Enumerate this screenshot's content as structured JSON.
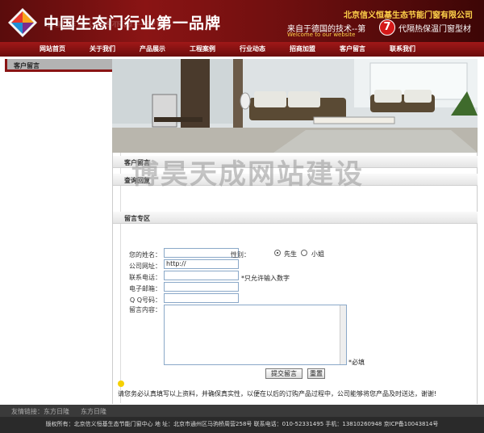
{
  "header": {
    "logo_title": "中国生态门行业第一品牌",
    "company": "北京信义恒基生态节能门窗有限公司",
    "slogan": "来自于德国的技术--第",
    "slogan_number": "7",
    "slogan_suffix": "代隔热保温门窗型材",
    "slogan_en": "Welcome to our website"
  },
  "nav": {
    "items": [
      "网站首页",
      "关于我们",
      "产品展示",
      "工程案例",
      "行业动态",
      "招商加盟",
      "客户留言",
      "联系我们"
    ]
  },
  "sidebar": {
    "title": "客户留言"
  },
  "content": {
    "breadcrumb": "客户留言",
    "watermark": "博昊天成网站建设",
    "view_replies": "查询回复",
    "message_zone": "留言专区"
  },
  "form": {
    "name_label": "您的姓名：",
    "name_value": "",
    "gender_label": "性别：",
    "gender_male": "先生",
    "gender_female": "小姐",
    "gender_selected": "先生",
    "website_label": "公司网址：",
    "website_value": "http://",
    "phone_label": "联系电话：",
    "phone_value": "",
    "phone_note": "*只允许输入数字",
    "email_label": "电子邮箱：",
    "email_value": "",
    "qq_label": "Q  Q号码：",
    "qq_value": "",
    "message_label": "留言内容：",
    "required_note": "*必填",
    "submit_label": "提交留言",
    "reset_label": "重置",
    "tip": "请您务必认真填写以上资料，并确保真实性，以便在以后的订购产品过程中，公司能够将您产品及时送达，谢谢!"
  },
  "footer": {
    "links_label": "友情链接：",
    "links": [
      "东方日隆",
      "东方日隆"
    ],
    "copyright": "版权所有：北京信义恒基生态节能门窗中心 地 址：北京市通州区马驹桥周营258号 联系电话：010-52331495 手机：13810260948 京ICP备10043814号"
  }
}
